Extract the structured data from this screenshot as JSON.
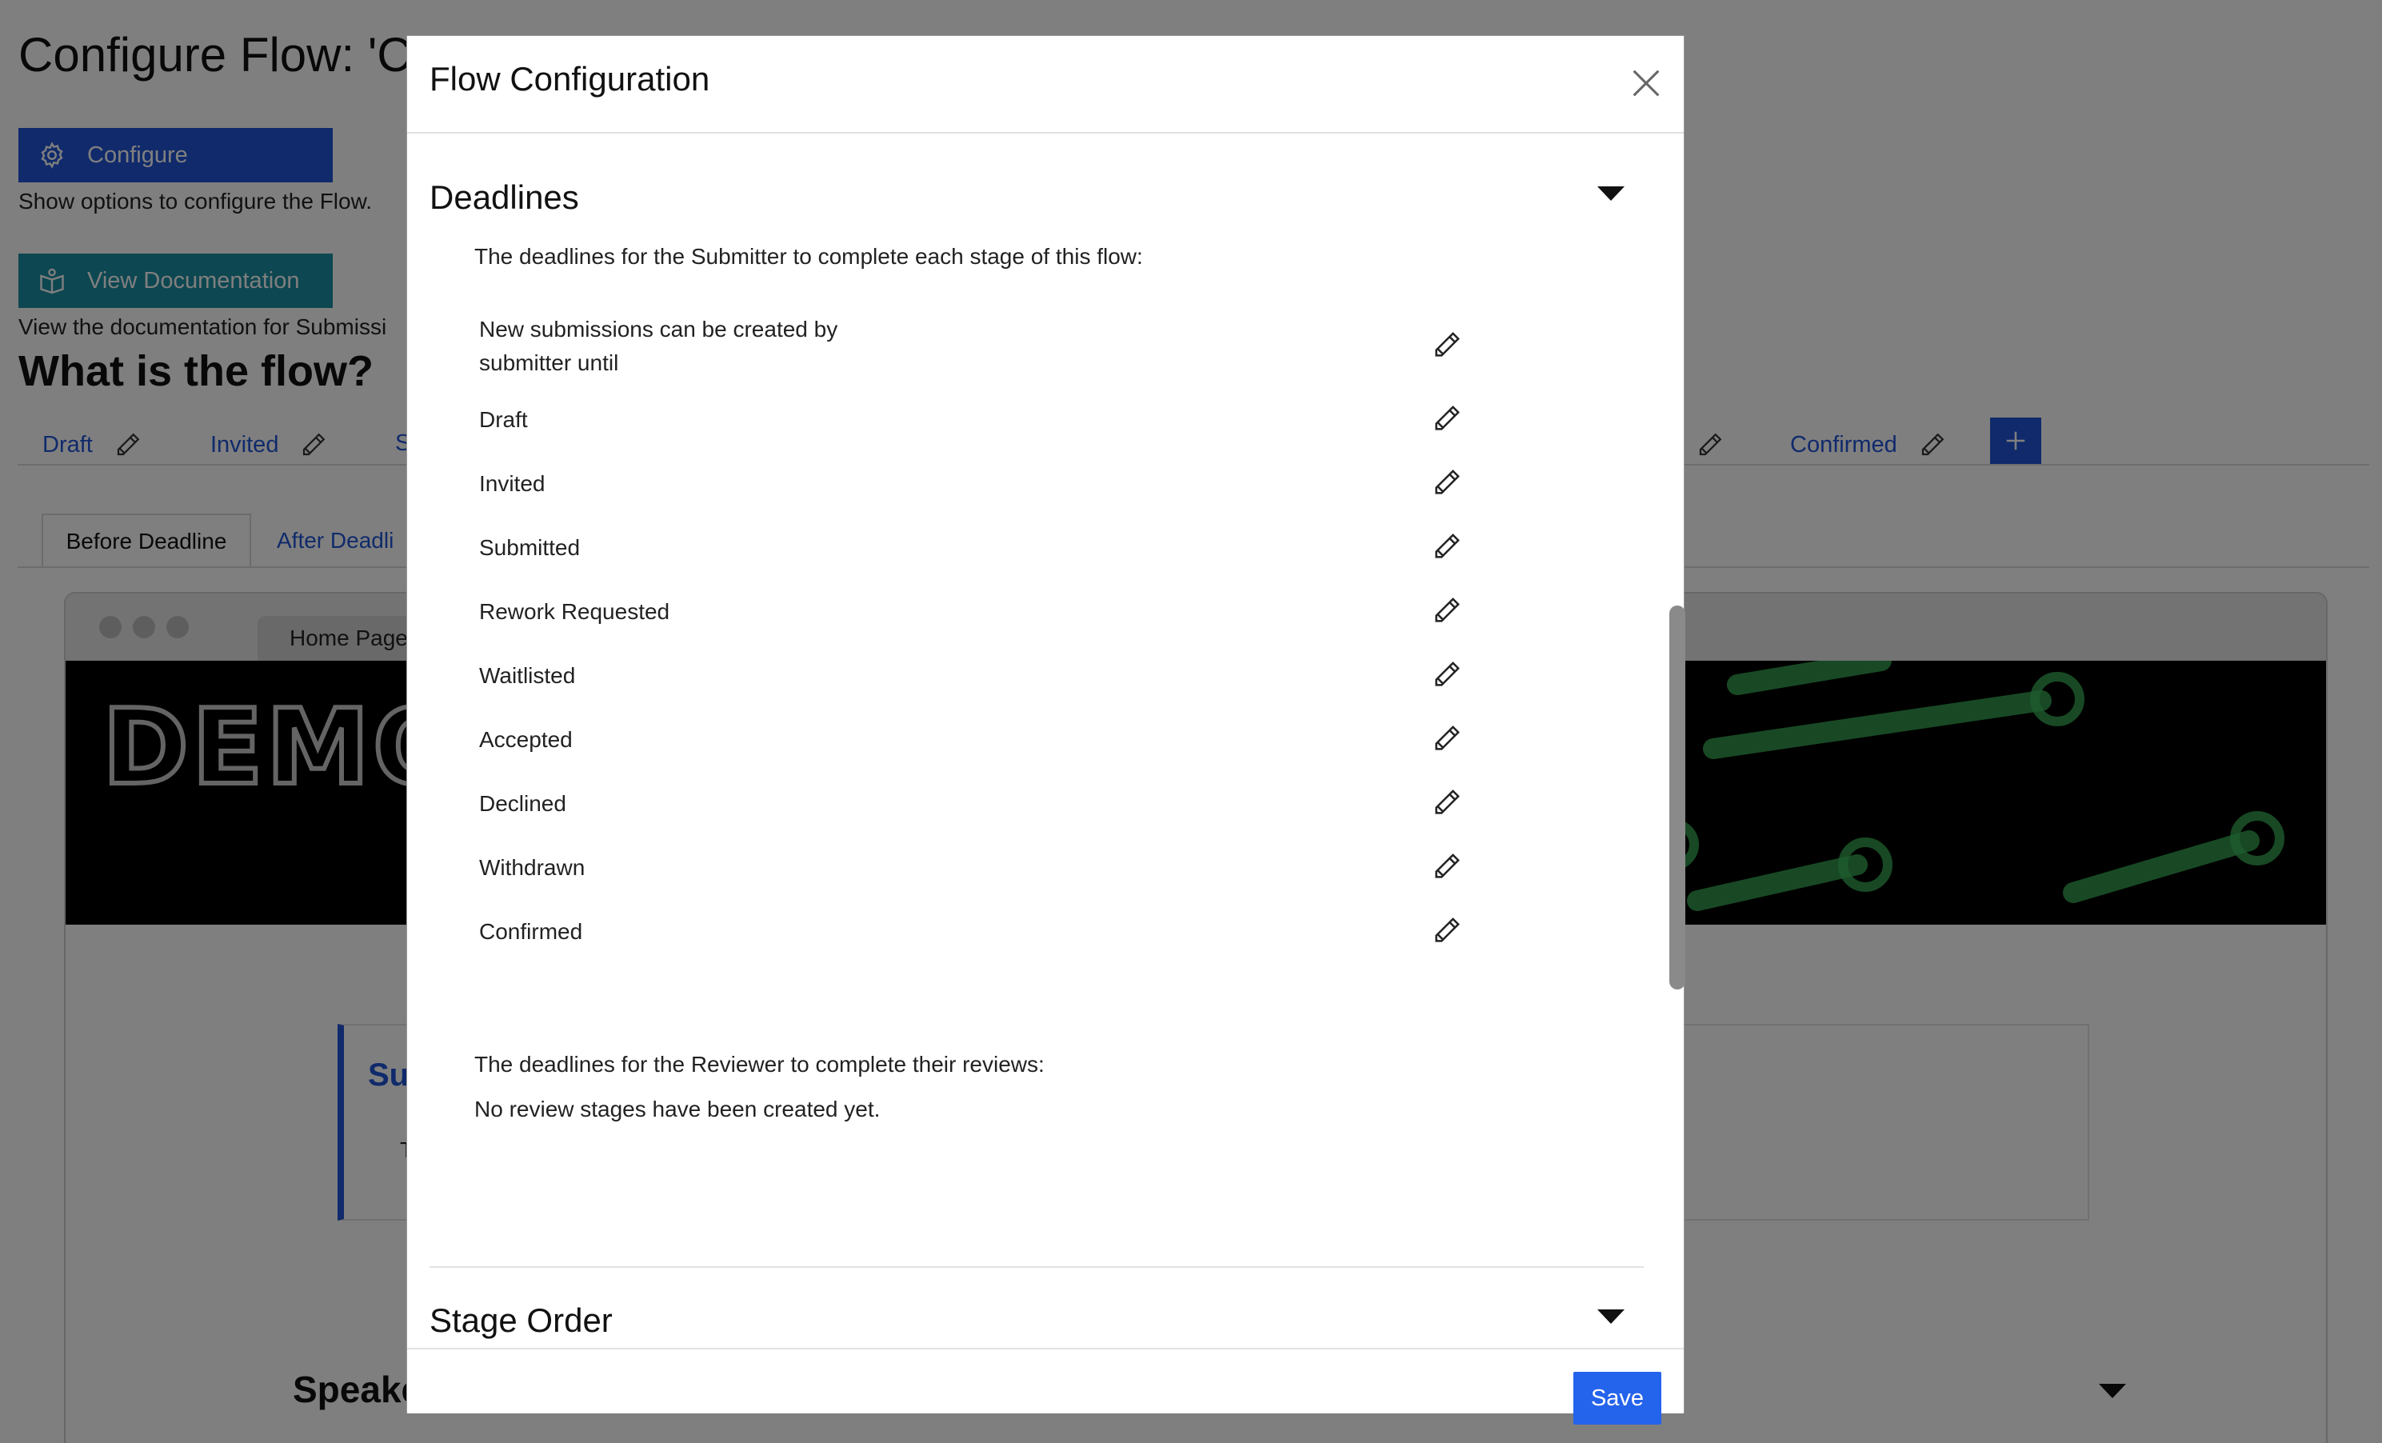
{
  "background": {
    "page_title": "Configure Flow: 'C",
    "configure_button": "Configure",
    "configure_help": "Show options to configure the Flow.",
    "docs_button": "View Documentation",
    "docs_help": "View the documentation for Submissi",
    "flow_heading": "What is the flow?",
    "stage_tabs": [
      "Draft",
      "Invited",
      "S",
      "Confirmed"
    ],
    "sub_tabs": [
      "Before Deadline",
      "After Deadli"
    ],
    "browser_tab": "Home Page",
    "banner_logo": "DEMO",
    "card_title": "Su",
    "card_text": "T",
    "speakers_heading": "Speake"
  },
  "modal": {
    "title": "Flow Configuration",
    "deadlines": {
      "title": "Deadlines",
      "submitter_intro": "The deadlines for the Submitter to complete each stage of this flow:",
      "items": [
        "New submissions can be created by submitter until",
        "Draft",
        "Invited",
        "Submitted",
        "Rework Requested",
        "Waitlisted",
        "Accepted",
        "Declined",
        "Withdrawn",
        "Confirmed"
      ],
      "reviewer_intro": "The deadlines for the Reviewer to complete their reviews:",
      "reviewer_empty": "No review stages have been created yet."
    },
    "stage_order": {
      "title": "Stage Order"
    },
    "save_label": "Save"
  },
  "icons": {
    "edit": "pencil-icon",
    "close": "close-icon",
    "caret": "caret-down-icon",
    "configure": "gear-icon",
    "docs": "book-icon",
    "add": "plus-icon"
  },
  "colors": {
    "primary": "#2155d6",
    "docs_button": "#1b8fa3",
    "save_button": "#2463eb",
    "overlay": "rgba(0,0,0,0.5)"
  }
}
